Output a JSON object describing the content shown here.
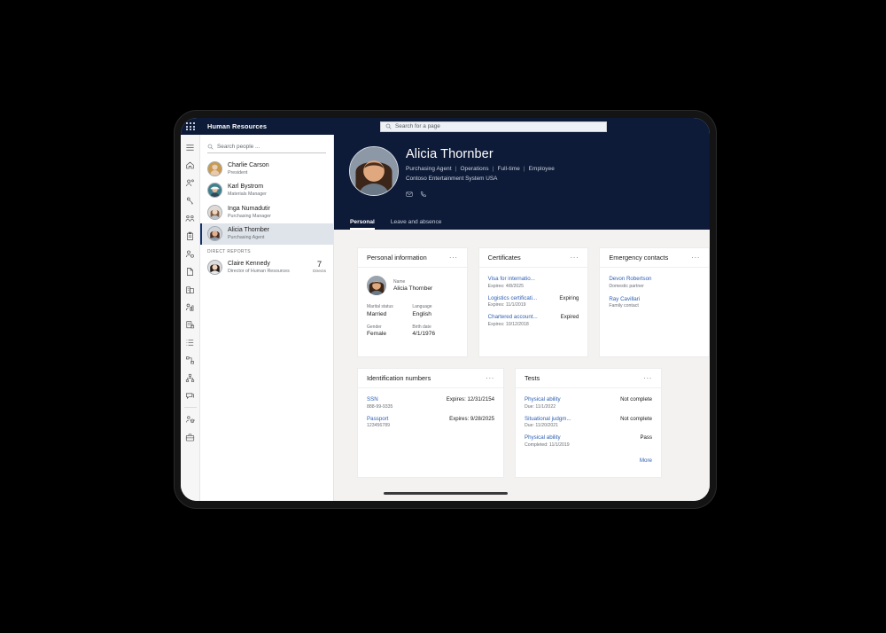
{
  "topbar": {
    "waffle_icon": "app-launcher-icon",
    "app_title": "Human Resources",
    "page_search_placeholder": "Search for a page",
    "search_icon": "search-icon"
  },
  "rail": {
    "items": [
      {
        "name": "hamburger-menu-icon",
        "label": "Menu"
      },
      {
        "name": "home-icon",
        "label": "Home"
      },
      {
        "name": "person-badge-icon",
        "label": "Employee self service"
      },
      {
        "name": "person-key-icon",
        "label": "Personnel management"
      },
      {
        "name": "people-group-icon",
        "label": "Teams"
      },
      {
        "name": "clipboard-icon",
        "label": "Tasks"
      },
      {
        "name": "person-gear-icon",
        "label": "Employee settings"
      },
      {
        "name": "document-tag-icon",
        "label": "Documents"
      },
      {
        "name": "buildings-icon",
        "label": "Organization"
      },
      {
        "name": "person-chart-icon",
        "label": "Performance"
      },
      {
        "name": "report-lock-icon",
        "label": "Compensation"
      },
      {
        "name": "list-icon",
        "label": "Lists"
      },
      {
        "name": "workflow-icon",
        "label": "Workflow"
      },
      {
        "name": "hierarchy-icon",
        "label": "Hierarchy"
      },
      {
        "name": "chat-icon",
        "label": "Feedback"
      },
      {
        "name": "learning-icon",
        "label": "Learning"
      },
      {
        "name": "briefcase-icon",
        "label": "Benefits"
      }
    ]
  },
  "people_panel": {
    "search_placeholder": "Search people ...",
    "search_icon": "search-icon",
    "people": [
      {
        "name": "Charlie Carson",
        "title": "President",
        "selected": false
      },
      {
        "name": "Karl Bystrom",
        "title": "Materials Manager",
        "selected": false
      },
      {
        "name": "Inga Numadutir",
        "title": "Purchasing Manager",
        "selected": false
      },
      {
        "name": "Alicia Thornber",
        "title": "Purchasing Agent",
        "selected": true
      }
    ],
    "direct_reports_label": "DIRECT REPORTS",
    "direct_reports": [
      {
        "name": "Claire Kennedy",
        "title": "Director of Human Resources",
        "count": "7",
        "count_label": "Directs"
      }
    ]
  },
  "profile": {
    "name": "Alicia Thornber",
    "meta": [
      "Purchasing Agent",
      "Operations",
      "Full-time",
      "Employee"
    ],
    "company": "Contoso Entertainment System USA",
    "contact_icons": [
      {
        "name": "email-icon"
      },
      {
        "name": "phone-icon"
      }
    ],
    "tabs": [
      {
        "label": "Personal",
        "active": true
      },
      {
        "label": "Leave and absence",
        "active": false
      }
    ]
  },
  "cards": {
    "personal_information": {
      "title": "Personal information",
      "overflow_icon": "more-options-icon",
      "name_label": "Name",
      "name_value": "Alicia Thornber",
      "fields": [
        {
          "label": "Marital status",
          "value": "Married"
        },
        {
          "label": "Language",
          "value": "English"
        },
        {
          "label": "Gender",
          "value": "Female"
        },
        {
          "label": "Birth date",
          "value": "4/1/1976"
        }
      ]
    },
    "certificates": {
      "title": "Certificates",
      "overflow_icon": "more-options-icon",
      "items": [
        {
          "name": "Visa for internatio...",
          "sub": "Expires: 4/8/2025",
          "status": ""
        },
        {
          "name": "Logistics certificati...",
          "sub": "Expires: 11/1/2019",
          "status": "Expiring"
        },
        {
          "name": "Chartered account...",
          "sub": "Expires: 10/12/2018",
          "status": "Expired"
        }
      ]
    },
    "emergency_contacts": {
      "title": "Emergency contacts",
      "overflow_icon": "more-options-icon",
      "items": [
        {
          "name": "Devon Robertson",
          "relation": "Domestic partner"
        },
        {
          "name": "Ray Cavillari",
          "relation": "Family contact"
        }
      ]
    },
    "identification_numbers": {
      "title": "Identification numbers",
      "overflow_icon": "more-options-icon",
      "items": [
        {
          "name": "SSN",
          "sub": "888-99-9335",
          "status": "Expires: 12/31/2154"
        },
        {
          "name": "Passport",
          "sub": "123456789",
          "status": "Expires: 9/28/2025"
        }
      ]
    },
    "tests": {
      "title": "Tests",
      "overflow_icon": "more-options-icon",
      "items": [
        {
          "name": "Physical ability",
          "sub": "Due: 11/1/2022",
          "status": "Not complete"
        },
        {
          "name": "Situational judgm...",
          "sub": "Due: 11/20/2021",
          "status": "Not complete"
        },
        {
          "name": "Physical ability",
          "sub": "Completed: 11/1/2019",
          "status": "Pass"
        }
      ],
      "more_label": "More"
    }
  },
  "colors": {
    "brand_navy": "#0d1b38",
    "canvas": "#f3f2f1",
    "link_blue": "#2e5fb3",
    "selected_row": "#dfe3ea",
    "device_frame": "#141414"
  }
}
